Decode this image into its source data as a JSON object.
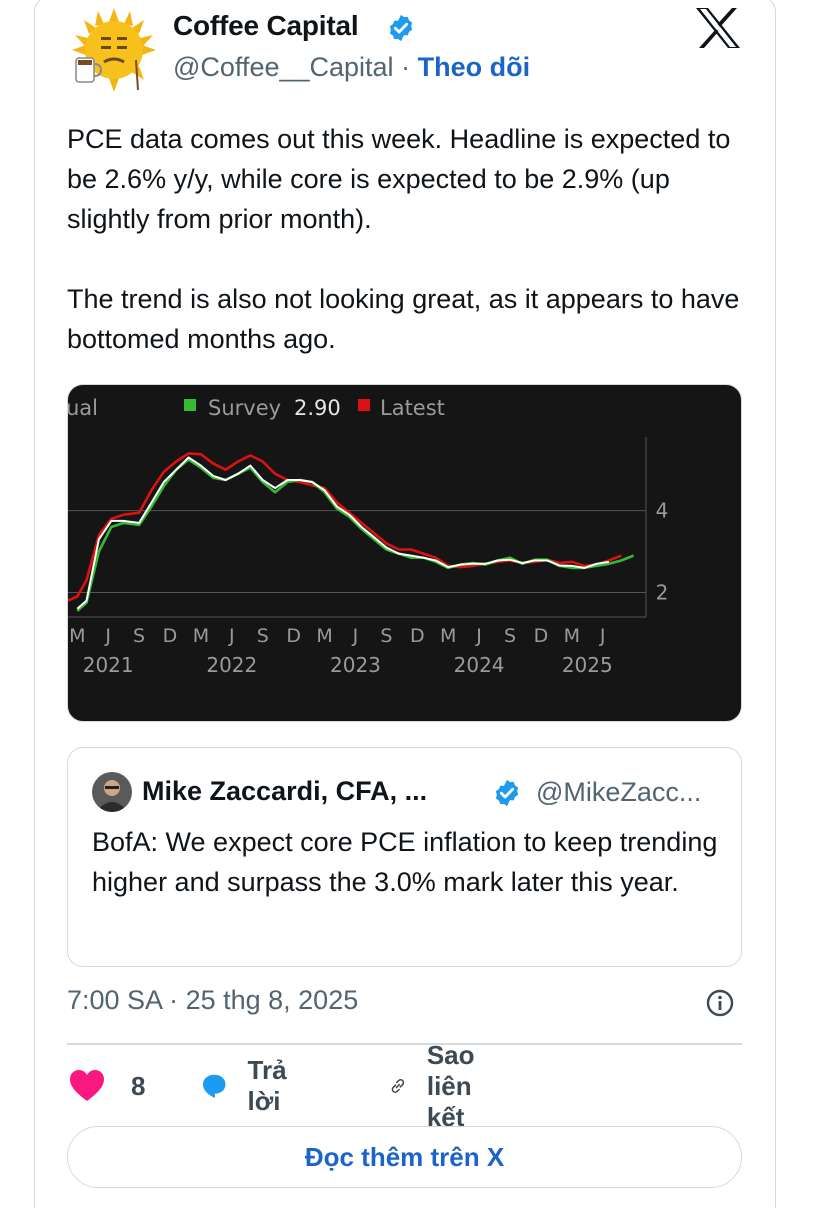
{
  "tweet": {
    "author_name": "Coffee Capital",
    "handle": "@Coffee__Capital",
    "separator": "·",
    "follow_label": "Theo dõi",
    "text_p1": "PCE data comes out this week. Headline is expected to be 2.6% y/y, while core is expected to be 2.9% (up slightly from prior month).",
    "text_p2": "The trend is also not looking great, as it appears to have bottomed months ago.",
    "timestamp": "7:00 SA · 25 thg 8, 2025"
  },
  "quote": {
    "author_name": "Mike Zaccardi, CFA, ...",
    "handle": "@MikeZacc...",
    "text": "BofA: We expect core PCE inflation to keep trending higher and surpass the 3.0% mark later this year."
  },
  "actions": {
    "like_count": "8",
    "reply_label": "Trả lời",
    "copy_link_label": "Sao liên kết"
  },
  "read_more_label": "Đọc thêm trên X",
  "colors": {
    "accent": "#1d64c8",
    "like": "#f91880",
    "reply_icon": "#1d9bf0",
    "chart_bg": "#151515",
    "survey": "#33bb33",
    "latest": "#dd1111",
    "actual": "#ffffff"
  },
  "icons": {
    "verified": "verified-badge-icon",
    "x_logo": "x-logo-icon",
    "info": "info-icon",
    "like": "heart-icon",
    "reply": "speech-bubble-icon",
    "copy_link": "link-icon"
  },
  "chart_data": {
    "type": "line",
    "legend": [
      {
        "label": "ual"
      },
      {
        "label": "Survey",
        "value": "2.90"
      },
      {
        "label": "Latest"
      }
    ],
    "y_ticks": [
      "2",
      "4"
    ],
    "ylim": [
      1.4,
      5.8
    ],
    "x_tick_labels": [
      "M",
      "J",
      "S",
      "D",
      "M",
      "J",
      "S",
      "D",
      "M",
      "J",
      "S",
      "D",
      "M",
      "J",
      "S",
      "D",
      "M",
      "J"
    ],
    "x_tick_index": [
      0,
      1,
      2,
      3,
      4,
      5,
      6,
      7,
      8,
      9,
      10,
      11,
      12,
      13,
      14,
      15,
      16,
      17
    ],
    "years": [
      {
        "label": "2021",
        "at": 1
      },
      {
        "label": "2022",
        "at": 5
      },
      {
        "label": "2023",
        "at": 9
      },
      {
        "label": "2024",
        "at": 13
      },
      {
        "label": "2025",
        "at": 16.5
      }
    ],
    "x_range": [
      -0.3,
      18.4
    ],
    "series": [
      {
        "key": "latest",
        "x": [
          -0.3,
          0,
          0.3,
          0.7,
          1.1,
          1.5,
          2,
          2.4,
          2.8,
          3.2,
          3.6,
          4,
          4.4,
          4.8,
          5.2,
          5.6,
          6,
          6.4,
          6.8,
          7.2,
          7.6,
          8,
          8.4,
          8.8,
          9.2,
          9.6,
          10,
          10.4,
          10.8,
          11.2,
          11.6,
          12,
          12.4,
          12.8,
          13.2,
          13.6,
          14,
          14.4,
          14.8,
          15.2,
          15.6,
          16,
          16.4,
          16.8,
          17.2,
          17.6
        ],
        "values": [
          1.8,
          1.9,
          2.3,
          3.4,
          3.8,
          3.9,
          3.95,
          4.5,
          4.95,
          5.2,
          5.4,
          5.38,
          5.15,
          5.0,
          5.2,
          5.35,
          5.2,
          4.9,
          4.75,
          4.7,
          4.62,
          4.55,
          4.2,
          3.95,
          3.7,
          3.45,
          3.2,
          3.05,
          3.05,
          2.95,
          2.85,
          2.65,
          2.62,
          2.65,
          2.7,
          2.75,
          2.78,
          2.72,
          2.75,
          2.8,
          2.72,
          2.75,
          2.65,
          2.68,
          2.78,
          2.9
        ]
      },
      {
        "key": "survey",
        "x": [
          0,
          0.3,
          0.7,
          1.1,
          1.5,
          2,
          2.4,
          2.8,
          3.2,
          3.6,
          4,
          4.4,
          4.8,
          5.2,
          5.6,
          6,
          6.4,
          6.8,
          7.2,
          7.6,
          8,
          8.4,
          8.8,
          9.2,
          9.6,
          10,
          10.4,
          10.8,
          11.2,
          11.6,
          12,
          12.4,
          12.8,
          13.2,
          13.6,
          14,
          14.4,
          14.8,
          15.2,
          15.6,
          16,
          16.4,
          16.8,
          17.2,
          17.6,
          18
        ],
        "values": [
          1.55,
          1.75,
          3.0,
          3.6,
          3.7,
          3.65,
          4.1,
          4.6,
          5.0,
          5.25,
          5.05,
          4.8,
          4.75,
          4.9,
          5.05,
          4.7,
          4.45,
          4.7,
          4.75,
          4.7,
          4.45,
          4.05,
          3.85,
          3.55,
          3.3,
          3.05,
          2.95,
          2.85,
          2.85,
          2.75,
          2.6,
          2.68,
          2.72,
          2.68,
          2.78,
          2.85,
          2.7,
          2.8,
          2.8,
          2.65,
          2.6,
          2.6,
          2.65,
          2.7,
          2.78,
          2.9
        ]
      },
      {
        "key": "actual",
        "x": [
          0,
          0.3,
          0.7,
          1.1,
          1.5,
          2,
          2.4,
          2.8,
          3.2,
          3.6,
          4,
          4.4,
          4.8,
          5.2,
          5.6,
          6,
          6.4,
          6.8,
          7.2,
          7.6,
          8,
          8.4,
          8.8,
          9.2,
          9.6,
          10,
          10.4,
          10.8,
          11.2,
          11.6,
          12,
          12.4,
          12.8,
          13.2,
          13.6,
          14,
          14.4,
          14.8,
          15.2,
          15.6,
          16,
          16.4,
          16.8,
          17.2
        ],
        "values": [
          1.6,
          1.8,
          3.3,
          3.75,
          3.75,
          3.7,
          4.2,
          4.7,
          5.0,
          5.3,
          5.1,
          4.85,
          4.75,
          4.9,
          5.1,
          4.75,
          4.55,
          4.75,
          4.75,
          4.7,
          4.5,
          4.1,
          3.9,
          3.6,
          3.35,
          3.1,
          2.95,
          2.9,
          2.85,
          2.78,
          2.62,
          2.68,
          2.7,
          2.7,
          2.78,
          2.8,
          2.72,
          2.78,
          2.78,
          2.66,
          2.65,
          2.6,
          2.7,
          2.75
        ]
      }
    ]
  }
}
